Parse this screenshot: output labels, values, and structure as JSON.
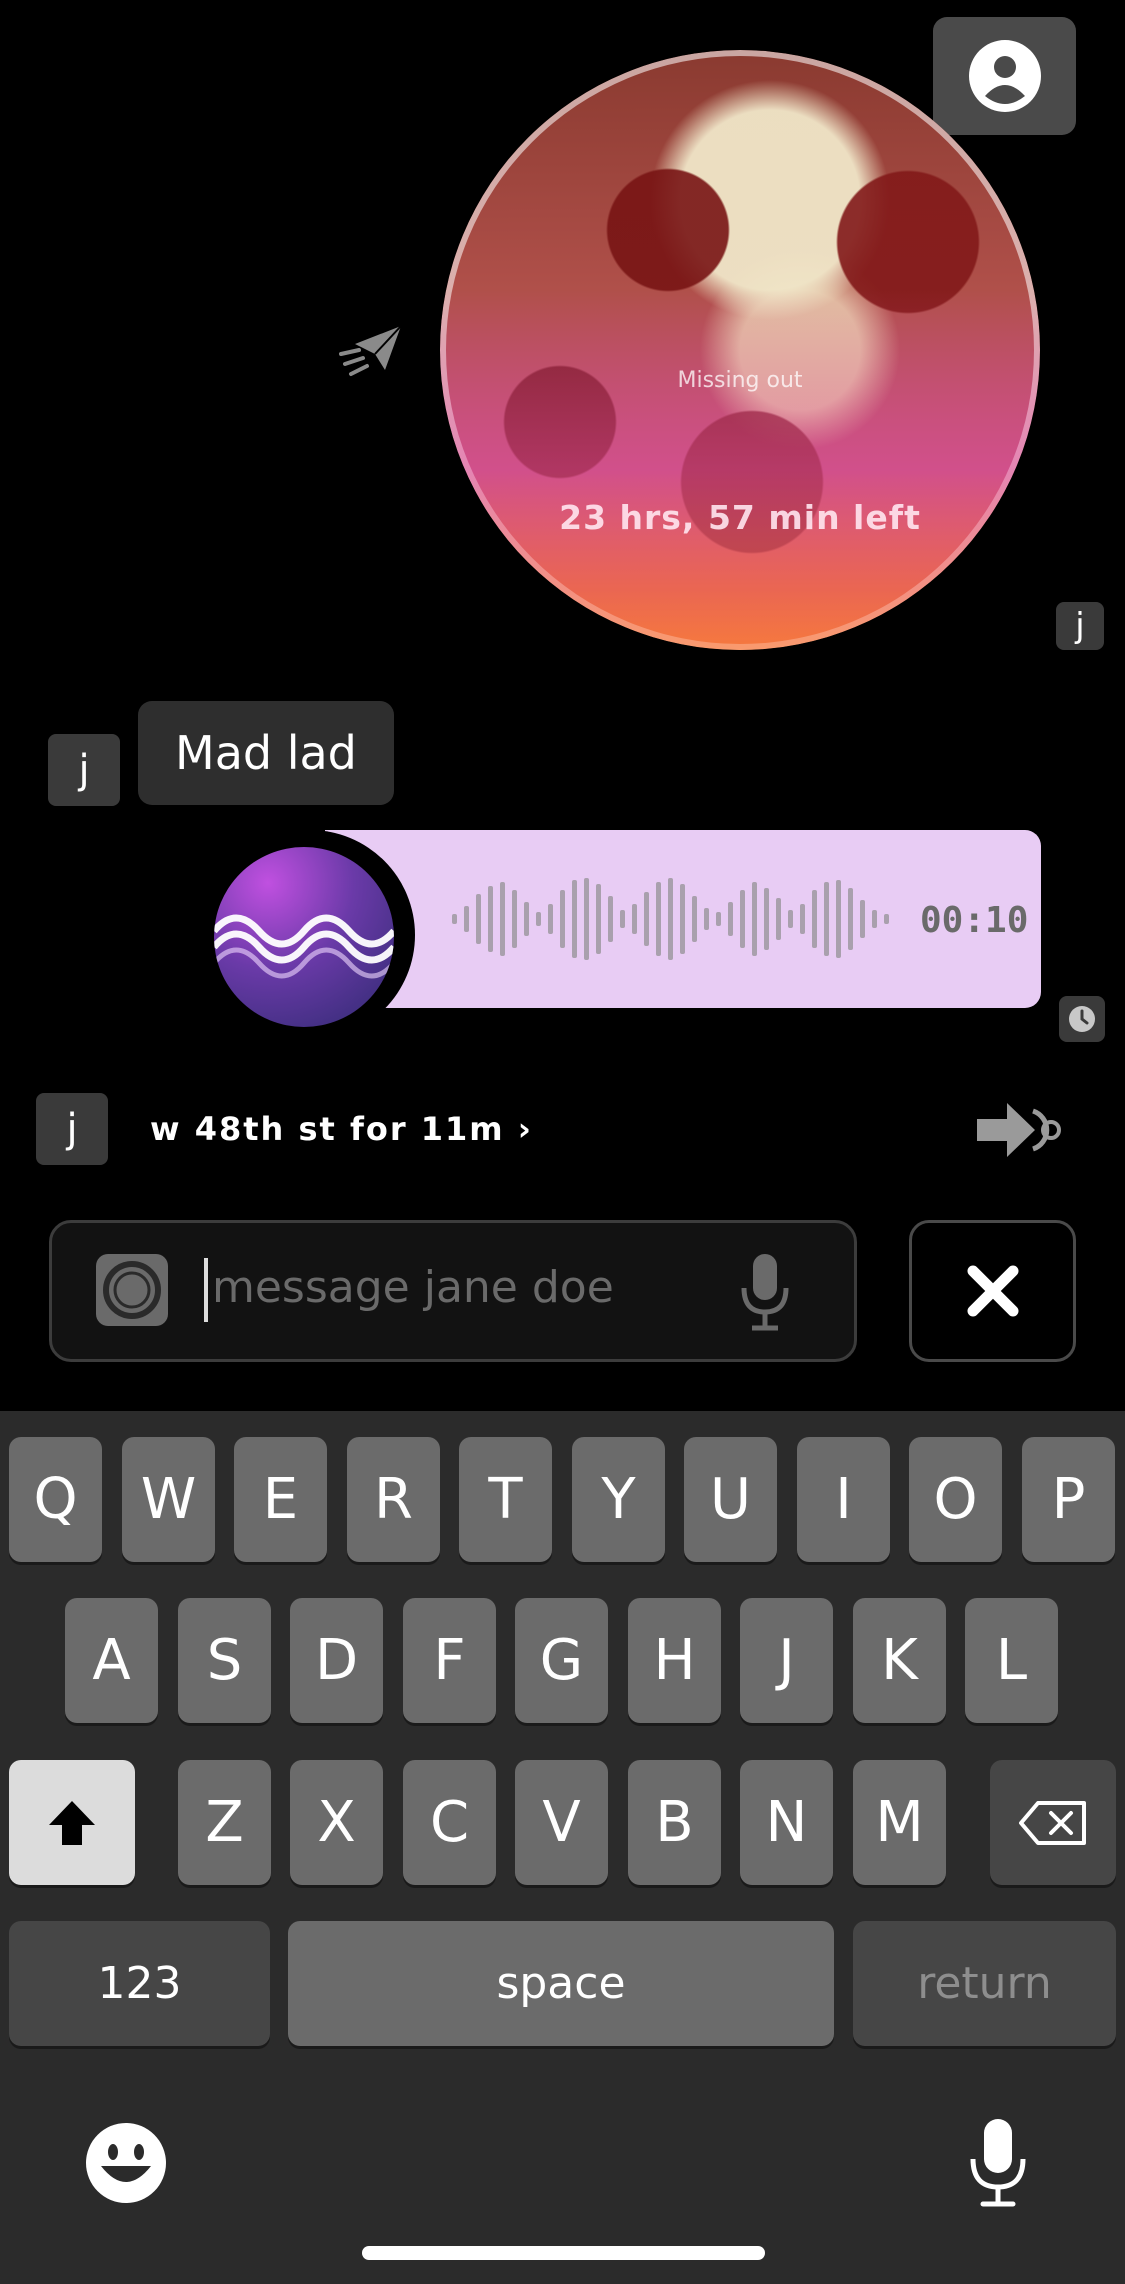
{
  "snap": {
    "caption": "Missing out",
    "timer": "23 hrs, 57 min left"
  },
  "avatars": {
    "snap_sender": "j",
    "bubble_sender": "j",
    "location_sender": "j"
  },
  "bubble": {
    "text": "Mad lad"
  },
  "voice_note": {
    "duration": "00:10"
  },
  "location": {
    "text": "w 48th st for 11m ›"
  },
  "input": {
    "placeholder": "message jane doe"
  },
  "keyboard": {
    "row1": [
      "Q",
      "W",
      "E",
      "R",
      "T",
      "Y",
      "U",
      "I",
      "O",
      "P"
    ],
    "row2": [
      "A",
      "S",
      "D",
      "F",
      "G",
      "H",
      "J",
      "K",
      "L"
    ],
    "row3": [
      "Z",
      "X",
      "C",
      "V",
      "B",
      "N",
      "M"
    ],
    "numbers_label": "123",
    "space_label": "space",
    "return_label": "return"
  },
  "icons": {
    "profile": "person-icon",
    "send": "paper-plane-icon",
    "clock": "clock-icon",
    "share_location": "arrow-location-icon",
    "camera": "camera-icon",
    "mic": "microphone-icon",
    "close": "close-icon",
    "shift": "shift-icon",
    "backspace": "backspace-icon",
    "emoji": "emoji-icon"
  },
  "colors": {
    "voice_bubble": "#e8ccf4",
    "keyboard_bg": "#2b2b2b"
  }
}
